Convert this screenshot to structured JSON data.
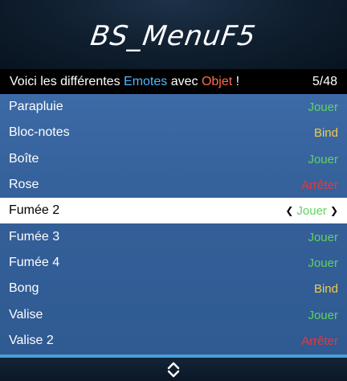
{
  "banner": {
    "title": "BS_MenuF5"
  },
  "subtitle": {
    "text_before": "Voici les différentes ",
    "emotes_word": "Emotes",
    "text_middle": " avec ",
    "objet_word": "Objet",
    "text_after": " !",
    "counter": "5/48"
  },
  "items": [
    {
      "label": "Parapluie",
      "action": "Jouer"
    },
    {
      "label": "Bloc-notes",
      "action": "Bind"
    },
    {
      "label": "Boîte",
      "action": "Jouer"
    },
    {
      "label": "Rose",
      "action": "Arrêter"
    },
    {
      "label": "Fumée 2",
      "action": "Jouer"
    },
    {
      "label": "Fumée 3",
      "action": "Jouer"
    },
    {
      "label": "Fumée 4",
      "action": "Jouer"
    },
    {
      "label": "Bong",
      "action": "Bind"
    },
    {
      "label": "Valise",
      "action": "Jouer"
    },
    {
      "label": "Valise 2",
      "action": "Arrêter"
    }
  ],
  "colors": {
    "jouer": "#5fd35f",
    "bind": "#f0cc4a",
    "arreter": "#e8383a",
    "emotes_highlight": "#4db8ff",
    "objet_highlight": "#ff6b4a",
    "list_background": "#3c6aa6"
  },
  "icons": {
    "footer": "up-down-chevron-icon",
    "selector_left": "chevron-left-icon",
    "selector_right": "chevron-right-icon"
  }
}
